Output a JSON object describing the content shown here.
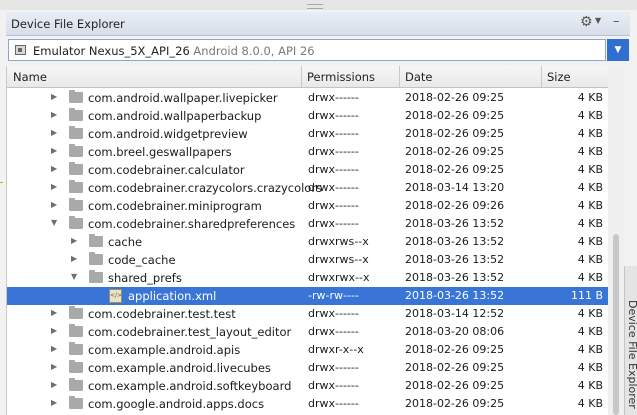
{
  "panel": {
    "title": "Device File Explorer",
    "gear_icon": "gear-icon",
    "minimize_icon": "minimize-icon"
  },
  "device": {
    "name": "Emulator Nexus_5X_API_26",
    "detail": "Android 8.0.0, API 26"
  },
  "columns": {
    "name": "Name",
    "permissions": "Permissions",
    "date": "Date",
    "size": "Size"
  },
  "rows": [
    {
      "level": 0,
      "expanded": false,
      "type": "folder",
      "name": "com.android.wallpaper.livepicker",
      "perm": "drwx------",
      "date": "2018-02-26 09:25",
      "size": "4 KB"
    },
    {
      "level": 0,
      "expanded": false,
      "type": "folder",
      "name": "com.android.wallpaperbackup",
      "perm": "drwx------",
      "date": "2018-02-26 09:25",
      "size": "4 KB"
    },
    {
      "level": 0,
      "expanded": false,
      "type": "folder",
      "name": "com.android.widgetpreview",
      "perm": "drwx------",
      "date": "2018-02-26 09:25",
      "size": "4 KB"
    },
    {
      "level": 0,
      "expanded": false,
      "type": "folder",
      "name": "com.breel.geswallpapers",
      "perm": "drwx------",
      "date": "2018-02-26 09:25",
      "size": "4 KB"
    },
    {
      "level": 0,
      "expanded": false,
      "type": "folder",
      "name": "com.codebrainer.calculator",
      "perm": "drwx------",
      "date": "2018-02-26 09:25",
      "size": "4 KB"
    },
    {
      "level": 0,
      "expanded": false,
      "type": "folder",
      "name": "com.codebrainer.crazycolors.crazycolors",
      "perm": "drwx------",
      "date": "2018-03-14 13:20",
      "size": "4 KB"
    },
    {
      "level": 0,
      "expanded": false,
      "type": "folder",
      "name": "com.codebrainer.miniprogram",
      "perm": "drwx------",
      "date": "2018-02-26 09:26",
      "size": "4 KB"
    },
    {
      "level": 0,
      "expanded": true,
      "type": "folder",
      "name": "com.codebrainer.sharedpreferences",
      "perm": "drwx------",
      "date": "2018-03-26 13:52",
      "size": "4 KB"
    },
    {
      "level": 1,
      "expanded": false,
      "type": "folder",
      "name": "cache",
      "perm": "drwxrws--x",
      "date": "2018-03-26 13:52",
      "size": "4 KB"
    },
    {
      "level": 1,
      "expanded": false,
      "type": "folder",
      "name": "code_cache",
      "perm": "drwxrws--x",
      "date": "2018-03-26 13:52",
      "size": "4 KB"
    },
    {
      "level": 1,
      "expanded": true,
      "type": "folder",
      "name": "shared_prefs",
      "perm": "drwxrwx--x",
      "date": "2018-03-26 13:52",
      "size": "4 KB"
    },
    {
      "level": 2,
      "expanded": null,
      "type": "xml",
      "selected": true,
      "name": "application.xml",
      "perm": "-rw-rw----",
      "date": "2018-03-26 13:52",
      "size": "111 B"
    },
    {
      "level": 0,
      "expanded": false,
      "type": "folder",
      "name": "com.codebrainer.test.test",
      "perm": "drwx------",
      "date": "2018-03-14 12:52",
      "size": "4 KB"
    },
    {
      "level": 0,
      "expanded": false,
      "type": "folder",
      "name": "com.codebrainer.test_layout_editor",
      "perm": "drwx------",
      "date": "2018-03-20 08:06",
      "size": "4 KB"
    },
    {
      "level": 0,
      "expanded": false,
      "type": "folder",
      "name": "com.example.android.apis",
      "perm": "drwxr-x--x",
      "date": "2018-02-26 09:25",
      "size": "4 KB"
    },
    {
      "level": 0,
      "expanded": false,
      "type": "folder",
      "name": "com.example.android.livecubes",
      "perm": "drwx------",
      "date": "2018-02-26 09:25",
      "size": "4 KB"
    },
    {
      "level": 0,
      "expanded": false,
      "type": "folder",
      "name": "com.example.android.softkeyboard",
      "perm": "drwx------",
      "date": "2018-02-26 09:25",
      "size": "4 KB"
    },
    {
      "level": 0,
      "expanded": false,
      "type": "folder",
      "name": "com.google.android.apps.docs",
      "perm": "drwx------",
      "date": "2018-02-26 09:25",
      "size": "4 KB"
    }
  ],
  "side_tab": "Device File Explorer",
  "colors": {
    "selection": "#3875d7",
    "combo_button": "#2f6fd0"
  }
}
